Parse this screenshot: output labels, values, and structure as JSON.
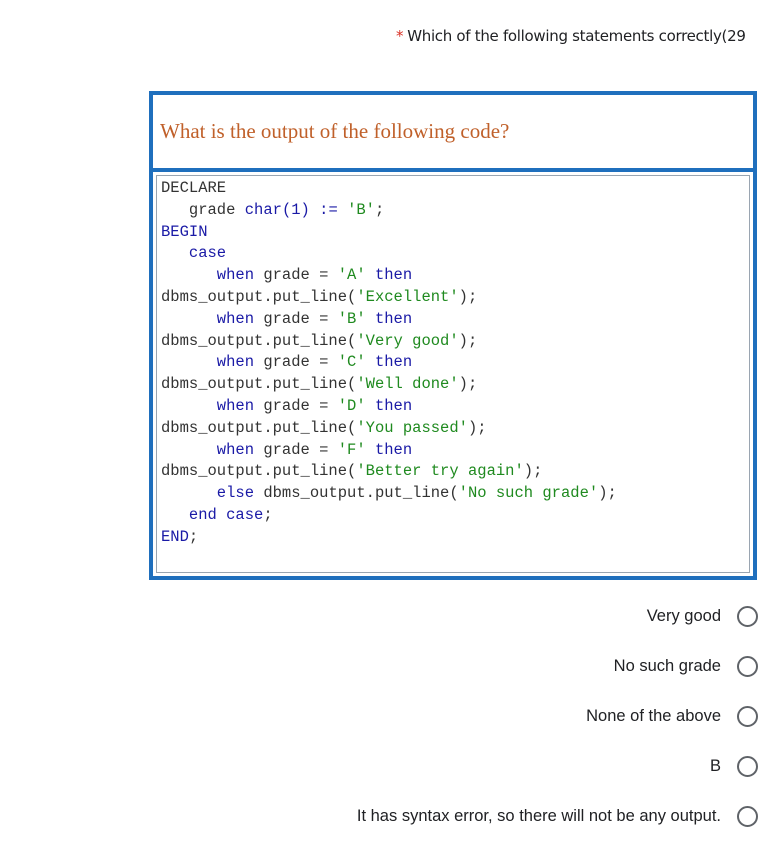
{
  "question": {
    "required_marker": "*",
    "text": "Which of the following statements correctly(29"
  },
  "code_image": {
    "title": "What is the output of the following code?",
    "lines": [
      [
        {
          "t": "DECLARE",
          "c": "plain"
        }
      ],
      [
        {
          "t": "   grade ",
          "c": "plain"
        },
        {
          "t": "char",
          "c": "kw"
        },
        {
          "t": "(1) ",
          "c": "kw"
        },
        {
          "t": ":= ",
          "c": "kw"
        },
        {
          "t": "'B'",
          "c": "str"
        },
        {
          "t": ";",
          "c": "plain"
        }
      ],
      [
        {
          "t": "BEGIN",
          "c": "kw"
        }
      ],
      [
        {
          "t": "   case",
          "c": "kw"
        }
      ],
      [
        {
          "t": "      when ",
          "c": "kw"
        },
        {
          "t": "grade = ",
          "c": "plain"
        },
        {
          "t": "'A'",
          "c": "str"
        },
        {
          "t": " then",
          "c": "kw"
        }
      ],
      [
        {
          "t": "dbms_output.put_line(",
          "c": "plain"
        },
        {
          "t": "'Excellent'",
          "c": "str"
        },
        {
          "t": ");",
          "c": "plain"
        }
      ],
      [
        {
          "t": "      when ",
          "c": "kw"
        },
        {
          "t": "grade = ",
          "c": "plain"
        },
        {
          "t": "'B'",
          "c": "str"
        },
        {
          "t": " then",
          "c": "kw"
        }
      ],
      [
        {
          "t": "dbms_output.put_line(",
          "c": "plain"
        },
        {
          "t": "'Very good'",
          "c": "str"
        },
        {
          "t": ");",
          "c": "plain"
        }
      ],
      [
        {
          "t": "      when ",
          "c": "kw"
        },
        {
          "t": "grade = ",
          "c": "plain"
        },
        {
          "t": "'C'",
          "c": "str"
        },
        {
          "t": " then",
          "c": "kw"
        }
      ],
      [
        {
          "t": "dbms_output.put_line(",
          "c": "plain"
        },
        {
          "t": "'Well done'",
          "c": "str"
        },
        {
          "t": ");",
          "c": "plain"
        }
      ],
      [
        {
          "t": "      when ",
          "c": "kw"
        },
        {
          "t": "grade = ",
          "c": "plain"
        },
        {
          "t": "'D'",
          "c": "str"
        },
        {
          "t": " then",
          "c": "kw"
        }
      ],
      [
        {
          "t": "dbms_output.put_line(",
          "c": "plain"
        },
        {
          "t": "'You passed'",
          "c": "str"
        },
        {
          "t": ");",
          "c": "plain"
        }
      ],
      [
        {
          "t": "      when ",
          "c": "kw"
        },
        {
          "t": "grade = ",
          "c": "plain"
        },
        {
          "t": "'F'",
          "c": "str"
        },
        {
          "t": " then",
          "c": "kw"
        }
      ],
      [
        {
          "t": "dbms_output.put_line(",
          "c": "plain"
        },
        {
          "t": "'Better try again'",
          "c": "str"
        },
        {
          "t": ");",
          "c": "plain"
        }
      ],
      [
        {
          "t": "      else ",
          "c": "kw"
        },
        {
          "t": "dbms_output.put_line(",
          "c": "plain"
        },
        {
          "t": "'No such grade'",
          "c": "str"
        },
        {
          "t": ");",
          "c": "plain"
        }
      ],
      [
        {
          "t": "   end case",
          "c": "kw"
        },
        {
          "t": ";",
          "c": "plain"
        }
      ],
      [
        {
          "t": "END",
          "c": "kw"
        },
        {
          "t": ";",
          "c": "plain"
        }
      ]
    ]
  },
  "options": [
    {
      "label": "Very good"
    },
    {
      "label": "No such grade"
    },
    {
      "label": "None of the above"
    },
    {
      "label": "B"
    },
    {
      "label": "It has syntax error, so there will not be any output."
    }
  ],
  "colors": {
    "accent_border": "#1f6fbd",
    "title_text": "#c0602a",
    "keyword": "#1a1aa6",
    "string": "#1f8a1f",
    "required": "#d93025"
  }
}
